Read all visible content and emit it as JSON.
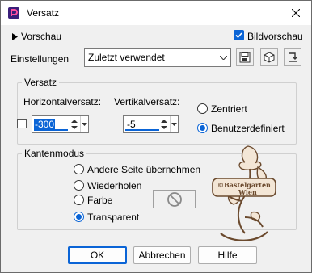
{
  "window": {
    "title": "Versatz"
  },
  "preview": {
    "label": "Vorschau",
    "bild_label": "Bildvorschau",
    "bild_checked": true
  },
  "settings": {
    "label": "Einstellungen",
    "preset_value": "Zuletzt verwendet"
  },
  "offset": {
    "group_label": "Versatz",
    "horizontal_label": "Horizontalversatz:",
    "vertical_label": "Vertikalversatz:",
    "horizontal_value": "-300",
    "vertical_value": "-5",
    "centered_label": "Zentriert",
    "custom_label": "Benutzerdefiniert",
    "selected": "custom"
  },
  "edge_mode": {
    "group_label": "Kantenmodus",
    "options": [
      "Andere Seite übernehmen",
      "Wiederholen",
      "Farbe",
      "Transparent"
    ],
    "selected": "Transparent"
  },
  "watermark": {
    "line1": "©Bastelgarten",
    "line2": "Wien"
  },
  "buttons": {
    "ok": "OK",
    "cancel": "Abbrechen",
    "help": "Hilfe"
  },
  "colors": {
    "accent": "#0a64d6",
    "dialog_bg": "#f0f0f0",
    "watermark": "#6b4a2e"
  }
}
